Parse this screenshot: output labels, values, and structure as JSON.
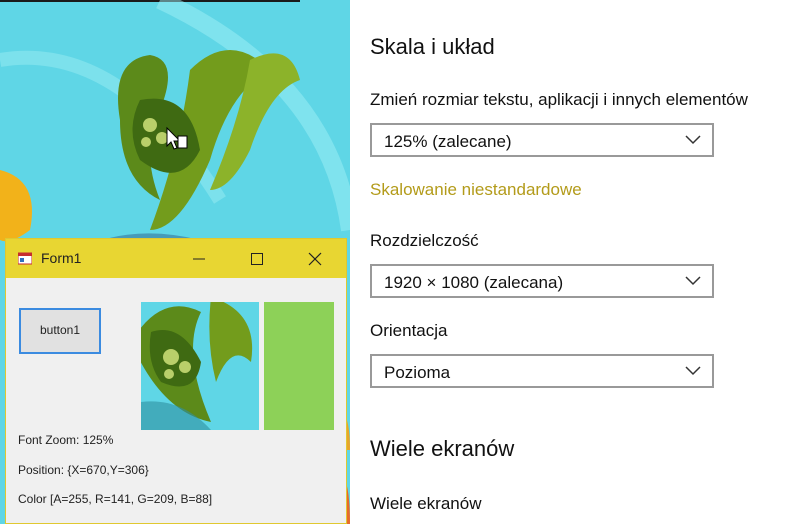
{
  "form1": {
    "title": "Form1",
    "button_label": "button1",
    "font_zoom": "Font Zoom: 125%",
    "position": "Position: {X=670,Y=306}",
    "color_text": "Color [A=255, R=141, G=209, B=88]",
    "swatch_color": "#8dd158"
  },
  "settings": {
    "section1_title": "Skala i układ",
    "scale_label": "Zmień rozmiar tekstu, aplikacji i innych elementów",
    "scale_value": "125% (zalecane)",
    "custom_scaling_link": "Skalowanie niestandardowe",
    "resolution_label": "Rozdzielczość",
    "resolution_value": "1920 × 1080 (zalecana)",
    "orientation_label": "Orientacja",
    "orientation_value": "Pozioma",
    "section2_title": "Wiele ekranów",
    "multi_label": "Wiele ekranów"
  },
  "colors": {
    "accent_link": "#b39b1a",
    "form_titlebar": "#e8d632",
    "wallpaper_cyan": "#5fd6e6"
  }
}
